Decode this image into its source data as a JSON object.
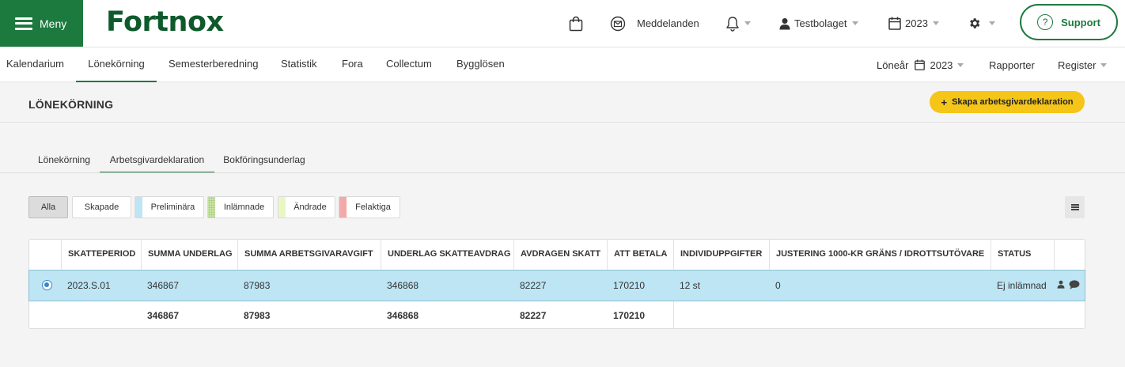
{
  "header": {
    "menu_label": "Meny",
    "logo_text": "Fortnox",
    "messages_label": "Meddelanden",
    "company_label": "Testbolaget",
    "year_label": "2023",
    "support_label": "Support",
    "support_icon_text": "?"
  },
  "nav": {
    "items": [
      {
        "label": "Kalendarium"
      },
      {
        "label": "Lönekörning"
      },
      {
        "label": "Semesterberedning"
      },
      {
        "label": "Statistik"
      },
      {
        "label": "Fora"
      },
      {
        "label": "Collectum"
      },
      {
        "label": "Bygglösen"
      }
    ],
    "active_index": 1,
    "loneyear_label": "Löneår",
    "loneyear_value": "2023",
    "reports_label": "Rapporter",
    "register_label": "Register"
  },
  "page": {
    "title": "LÖNEKÖRNING",
    "create_button": "Skapa arbetsgivardeklaration",
    "create_icon": "+"
  },
  "subtabs": {
    "items": [
      {
        "label": "Lönekörning"
      },
      {
        "label": "Arbetsgivardeklaration"
      },
      {
        "label": "Bokföringsunderlag"
      }
    ],
    "active_index": 1
  },
  "filters": [
    {
      "label": "Alla",
      "color": ""
    },
    {
      "label": "Skapade",
      "color": ""
    },
    {
      "label": "Preliminära",
      "color": "#bde5f4"
    },
    {
      "label": "Inlämnade",
      "color": "#c9e3a8"
    },
    {
      "label": "Ändrade",
      "color": "#e9f7c4"
    },
    {
      "label": "Felaktiga",
      "color": "#f5a9a9"
    }
  ],
  "table": {
    "columns": [
      "SKATTEPERIOD",
      "SUMMA UNDERLAG",
      "SUMMA ARBETSGIVARAVGIFT",
      "UNDERLAG SKATTEAVDRAG",
      "AVDRAGEN SKATT",
      "ATT BETALA",
      "INDIVIDUPPGIFTER",
      "JUSTERING 1000-KR GRÄNS / IDROTTSUTÖVARE",
      "STATUS"
    ],
    "row": {
      "period": "2023.S.01",
      "summa_underlag": "346867",
      "summa_avgift": "87983",
      "underlag_skatteavdrag": "346868",
      "avdragen_skatt": "82227",
      "att_betala": "170210",
      "individuppgifter": "12 st",
      "justering": "0",
      "status": "Ej inlämnad"
    },
    "footer": {
      "summa_underlag": "346867",
      "summa_avgift": "87983",
      "underlag_skatteavdrag": "346868",
      "avdragen_skatt": "82227",
      "att_betala": "170210"
    }
  },
  "colors": {
    "brand_green": "#1d7a3f",
    "accent_yellow": "#f5c518",
    "selected_row": "#bde5f4"
  }
}
